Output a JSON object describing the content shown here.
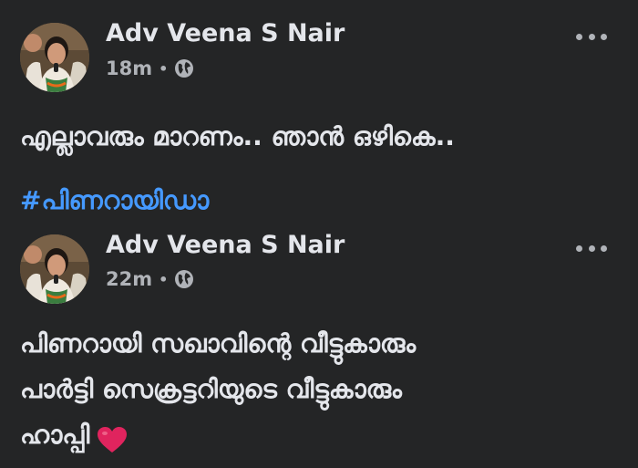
{
  "posts": [
    {
      "author": "Adv Veena S Nair",
      "time": "18m",
      "separator": "•",
      "privacy_icon": "globe-icon",
      "text_lines": [
        "എല്ലാവരും മാറണം.. ഞാൻ ഒഴികെ.."
      ],
      "hashtag": "#പിണറായിഡാ"
    },
    {
      "author": "Adv Veena S Nair",
      "time": "22m",
      "separator": "•",
      "privacy_icon": "globe-icon",
      "text_lines": [
        "പിണറായി സഖാവിന്റെ വീട്ടുകാരും",
        "പാർട്ടി സെക്രട്ടറിയുടെ വീട്ടുകാരും",
        "ഹാപ്പി"
      ],
      "emoji": "red-heart-icon"
    }
  ],
  "colors": {
    "background": "#242526",
    "primary_text": "#e4e6eb",
    "secondary_text": "#b0b3b8",
    "hashtag": "#4599ff",
    "heart": "#e0245e"
  }
}
